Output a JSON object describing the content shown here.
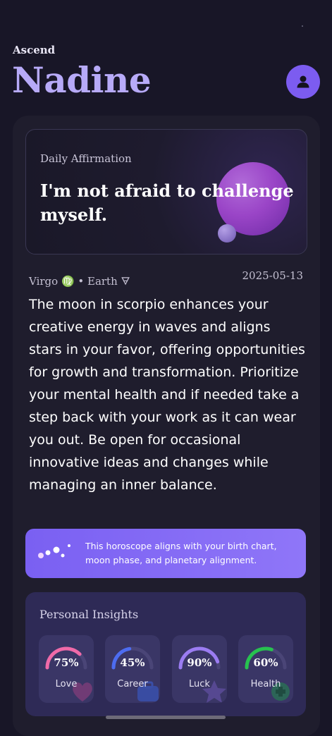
{
  "header": {
    "app_label": "Ascend",
    "user_name": "Nadine"
  },
  "affirmation": {
    "label": "Daily Affirmation",
    "text": "I'm not afraid to challenge myself."
  },
  "reading": {
    "sign_line": "Virgo ♍ • Earth 🜃",
    "date": "2025-05-13",
    "text": "The moon in scorpio enhances your creative energy in waves and aligns stars in your favor, offering opportunities for growth and transformation. Prioritize your mental health and if needed take a step back with your work as it can wear you out. Be open for occasional innovative ideas and changes while managing an inner balance."
  },
  "info_banner": {
    "text": "This horoscope aligns with your birth chart, moon phase, and planetary alignment."
  },
  "insights": {
    "title": "Personal Insights",
    "items": [
      {
        "label": "Love",
        "value": 75,
        "value_text": "75%",
        "color": "#f06aa8",
        "icon": "heart-icon"
      },
      {
        "label": "Career",
        "value": 45,
        "value_text": "45%",
        "color": "#4d6cf0",
        "icon": "briefcase-icon"
      },
      {
        "label": "Luck",
        "value": 90,
        "value_text": "90%",
        "color": "#9b7cf2",
        "icon": "star-icon"
      },
      {
        "label": "Health",
        "value": 60,
        "value_text": "60%",
        "color": "#27c24f",
        "icon": "health-icon"
      }
    ]
  },
  "colors": {
    "background": "#181627",
    "accent": "#7c5cf0",
    "name": "#b7aaf8"
  }
}
